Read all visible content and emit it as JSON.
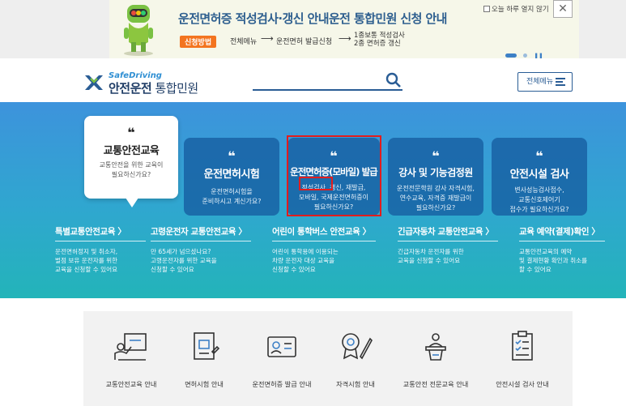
{
  "banner": {
    "title": "운전면허증 적성검사·갱신 안내운전 통합민원 신청 안내",
    "method_badge": "신청방법",
    "step1": "전체메뉴",
    "arrow": "⟶",
    "step2": "운전면허 발급신청",
    "step3_line1": "1종보통 적성검사",
    "step3_line2": "2종 면허증 갱신",
    "today_label": "오늘 하루 열지 않기",
    "close_symbol": "✕"
  },
  "header": {
    "logo_en": "SafeDriving",
    "logo_ko_main": "안전운전",
    "logo_ko_sub": " 통합민원",
    "menu_label": "전체메뉴"
  },
  "cards": [
    {
      "quote": "❝",
      "title": "교통안전교육",
      "desc": "교통안전을 위한 교육이\n필요하신가요?"
    },
    {
      "quote": "❝",
      "title": "운전면허시험",
      "desc": "운전면허시험을\n준비하시고 계신가요?"
    },
    {
      "quote": "❝",
      "title": "운전면허증(모바일) 발급",
      "desc": "적성검사, 갱신, 재발급,\n모바일, 국제운전면허증이\n필요하신가요?"
    },
    {
      "quote": "❝",
      "title": "강사 및 기능검정원",
      "desc": "운전전문학원 강사 자격시험,\n연수교육, 자격증 재발급이\n필요하신가요?"
    },
    {
      "quote": "❝",
      "title": "안전시설 검사",
      "desc": "변사성능검사접수,\n교통신호제어기\n접수가 필요하신가요?"
    }
  ],
  "links": [
    {
      "title": "특별교통안전교육 〉",
      "desc": "운전면허정지 및 취소자,\n벌점 보유 운전자를 위한\n교육을 신청할 수 있어요"
    },
    {
      "title": "고령운전자 교통안전교육 〉",
      "desc": "만 65세가 넘으셨나요?\n고령운전자를 위한 교육을\n신청할 수 있어요"
    },
    {
      "title": "어린이 통학버스 안전교육 〉",
      "desc": "어린이 통학용에 이용되는\n차량 운전자 대상 교육을\n신청할 수 있어요"
    },
    {
      "title": "긴급자동차 교통안전교육 〉",
      "desc": "긴급자동차 운전자를 위한\n교육을 신청할 수 있어요"
    },
    {
      "title": "교육 예약(결제)확인 〉",
      "desc": "교통안전교육의 예약\n및 결제현황 확인과 취소를\n할 수 있어요"
    }
  ],
  "icon_bar": [
    {
      "icon": "teacher-board-icon",
      "label": "교통안전교육 안내"
    },
    {
      "icon": "exam-paper-icon",
      "label": "면허시험 안내"
    },
    {
      "icon": "license-card-icon",
      "label": "운전면허증 발급 안내"
    },
    {
      "icon": "certificate-pen-icon",
      "label": "자격시험 안내"
    },
    {
      "icon": "lecturer-podium-icon",
      "label": "교통안전 전문교육 안내"
    },
    {
      "icon": "checklist-icon",
      "label": "안전시설 검사 안내"
    }
  ],
  "colors": {
    "brand": "#2a5d95",
    "accent": "#f3741f",
    "highlight": "#e21d1d"
  }
}
